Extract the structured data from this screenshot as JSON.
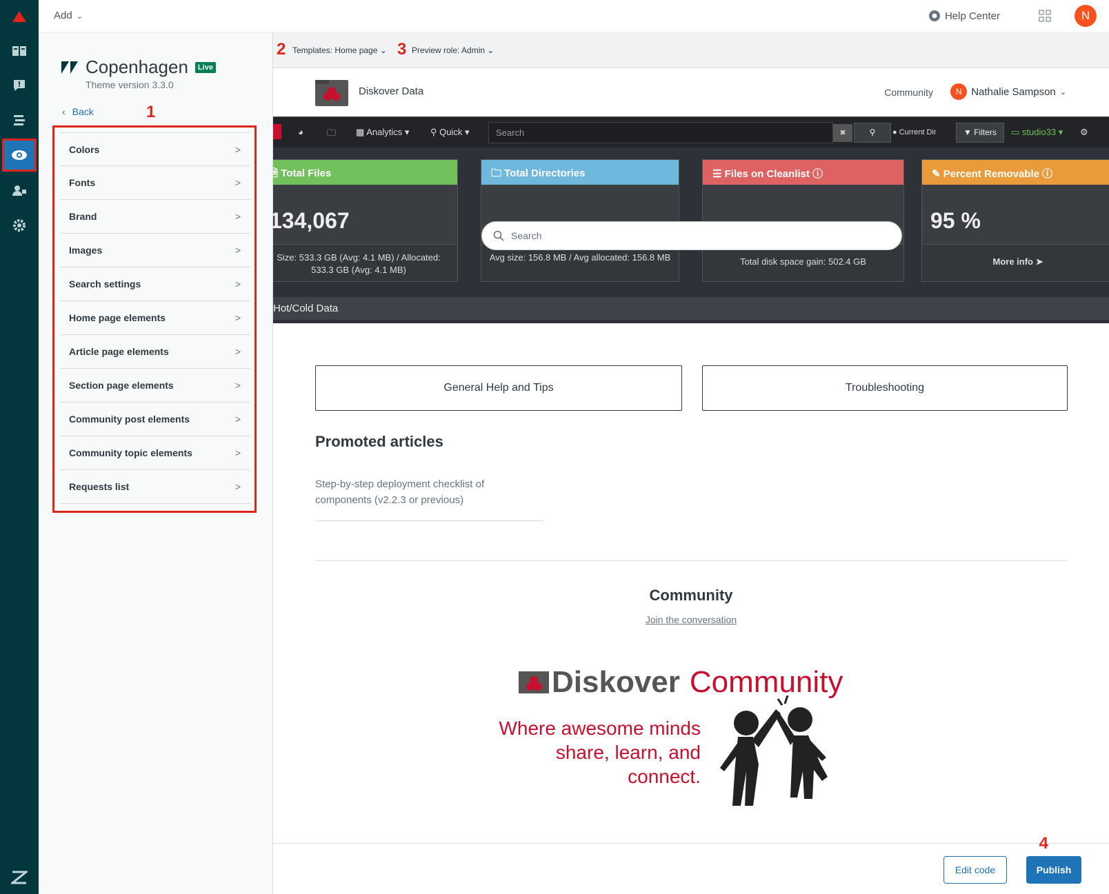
{
  "topbar": {
    "add_label": "Add",
    "help_center_label": "Help Center",
    "avatar_initial": "N"
  },
  "panel": {
    "theme_name": "Copenhagen",
    "live_badge": "Live",
    "theme_version": "Theme version 3.3.0",
    "back_label": "Back",
    "items": [
      {
        "label": "Colors"
      },
      {
        "label": "Fonts"
      },
      {
        "label": "Brand"
      },
      {
        "label": "Images"
      },
      {
        "label": "Search settings"
      },
      {
        "label": "Home page elements"
      },
      {
        "label": "Article page elements"
      },
      {
        "label": "Section page elements"
      },
      {
        "label": "Community post elements"
      },
      {
        "label": "Community topic elements"
      },
      {
        "label": "Requests list"
      }
    ]
  },
  "annotations": {
    "one": "1",
    "two": "2",
    "three": "3",
    "four": "4"
  },
  "preview_bar": {
    "template_label": "Templates: Home page",
    "role_label": "Preview role: Admin"
  },
  "hc": {
    "site_title": "Diskover Data",
    "community_link": "Community",
    "user_initial": "N",
    "user_name": "Nathalie Sampson",
    "search_placeholder": "Search",
    "blocks": [
      "General Help and Tips",
      "Troubleshooting"
    ],
    "promoted_heading": "Promoted articles",
    "promoted_article": "Step-by-step deployment checklist of components (v2.2.3 or previous)",
    "community_heading": "Community",
    "community_link_text": "Join the conversation",
    "banner_word1": "Diskover",
    "banner_word2": "Community",
    "tagline": "Where awesome minds share, learn, and connect."
  },
  "diskover": {
    "nav_analytics": "Analytics",
    "nav_quick": "Quick",
    "search_placeholder": "Search",
    "current_dir": "Current Dir",
    "filters": "Filters",
    "host": "studio33",
    "cards": [
      {
        "title": "Total Files",
        "value": "134,067",
        "footer": "Size: 533.3 GB (Avg: 4.1 MB) / Allocated: 533.3 GB (Avg: 4.1 MB)",
        "color": "#72c05b"
      },
      {
        "title": "Total Directories",
        "value": "",
        "footer": "Avg size: 156.8 MB / Avg allocated: 156.8 MB",
        "color": "#6fb8dd"
      },
      {
        "title": "Files on Cleanlist",
        "value": "",
        "footer": "Total disk space gain: 502.4 GB",
        "color": "#de6262"
      },
      {
        "title": "Percent Removable",
        "value": "95 %",
        "footer": "More info",
        "color": "#e99a3a"
      }
    ],
    "hot_cold": "Hot/Cold Data"
  },
  "footer": {
    "edit_code": "Edit code",
    "publish": "Publish"
  }
}
